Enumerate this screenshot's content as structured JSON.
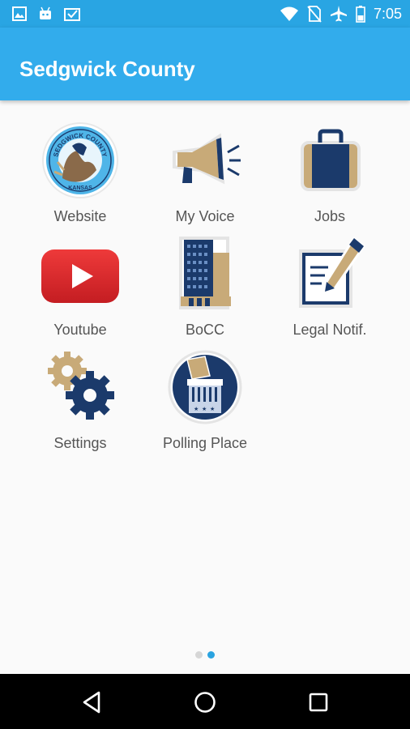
{
  "status_bar": {
    "time": "7:05",
    "left_icons": [
      "image-icon",
      "android-icon",
      "download-done-icon"
    ],
    "right_icons": [
      "wifi-icon",
      "no-sim-icon",
      "airplane-icon",
      "battery-icon"
    ]
  },
  "app_bar": {
    "title": "Sedgwick County"
  },
  "tiles": [
    {
      "label": "Website",
      "icon": "county-seal-icon"
    },
    {
      "label": "My Voice",
      "icon": "megaphone-icon"
    },
    {
      "label": "Jobs",
      "icon": "briefcase-icon"
    },
    {
      "label": "Youtube",
      "icon": "youtube-icon"
    },
    {
      "label": "BoCC",
      "icon": "building-icon"
    },
    {
      "label": "Legal Notif.",
      "icon": "document-pen-icon"
    },
    {
      "label": "Settings",
      "icon": "gears-icon"
    },
    {
      "label": "Polling Place",
      "icon": "ballot-box-icon"
    }
  ],
  "seal": {
    "top": "SEDGWICK COUNTY",
    "bottom": "KANSAS"
  },
  "pager": {
    "pages": 2,
    "current": 2
  },
  "colors": {
    "status_bar": "#29a5e3",
    "app_bar": "#32acec",
    "navy": "#1b3a6b",
    "tan": "#c8aa78",
    "youtube_red": "#e02a2a",
    "dot_active": "#2aa3e0",
    "dot_inactive": "#d6d6d6"
  },
  "nav": {
    "buttons": [
      "back-icon",
      "home-icon",
      "recents-icon"
    ]
  }
}
